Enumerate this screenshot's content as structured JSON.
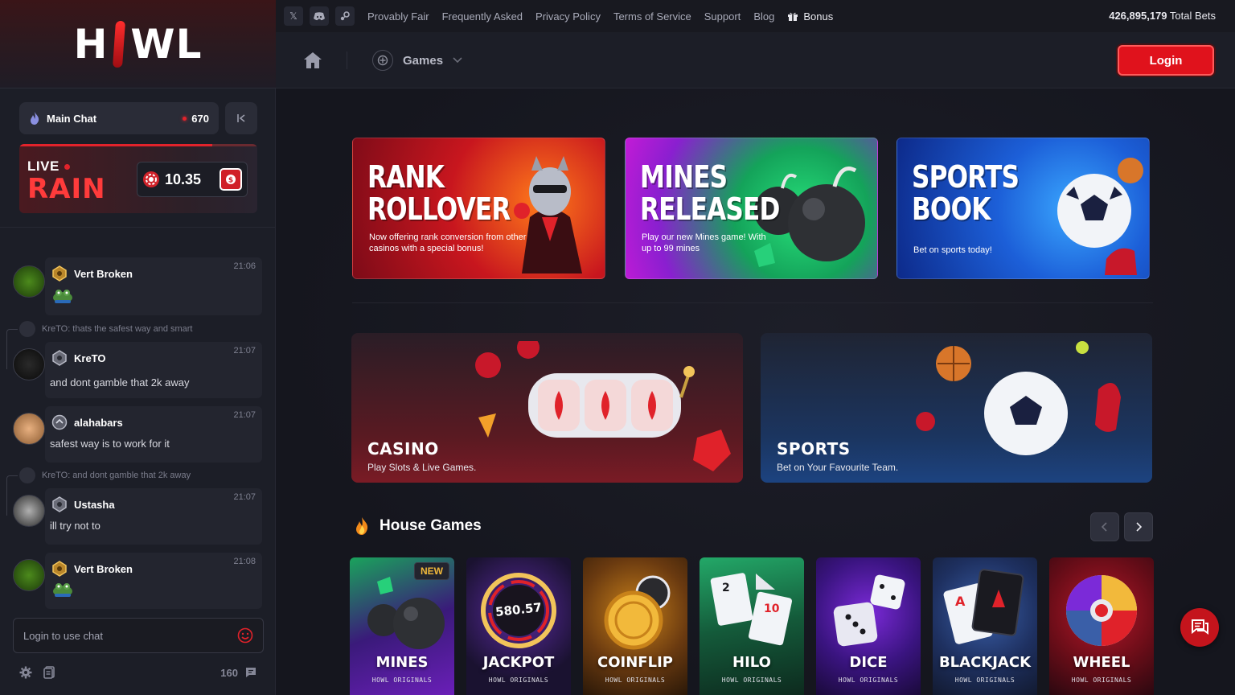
{
  "brand": {
    "logo_left": "H",
    "logo_right": "WL"
  },
  "topbar": {
    "links": [
      "Provably Fair",
      "Frequently Asked",
      "Privacy Policy",
      "Terms of Service",
      "Support",
      "Blog"
    ],
    "bonus_label": "Bonus",
    "total_bets_value": "426,895,179",
    "total_bets_label": "Total Bets"
  },
  "nav": {
    "games_label": "Games",
    "login_label": "Login"
  },
  "chat": {
    "room_name": "Main Chat",
    "online_count": "670",
    "rain": {
      "live_label": "LIVE",
      "rain_label": "RAIN",
      "amount": "10.35"
    },
    "messages": [
      {
        "name": "Vert Broken",
        "time": "21:06",
        "text": ""
      },
      {
        "reply": "KreTO: thats the safest way and smart",
        "name": "KreTO",
        "time": "21:07",
        "text": "and dont gamble that 2k away"
      },
      {
        "name": "alahabars",
        "time": "21:07",
        "text": "safest way is to work for it"
      },
      {
        "reply": "KreTO: and dont gamble that 2k away",
        "name": "Ustasha",
        "time": "21:07",
        "text": "ill try not to"
      },
      {
        "name": "Vert Broken",
        "time": "21:08",
        "text": ""
      }
    ],
    "input_placeholder": "Login to use chat",
    "footer_count": "160"
  },
  "banners": [
    {
      "title_line1": "RANK",
      "title_line2": "ROLLOVER",
      "subtitle": "Now offering rank conversion from other casinos with a special bonus!"
    },
    {
      "title_line1": "MINES",
      "title_line2": "RELEASED",
      "subtitle": "Play our new Mines game! With up to 99 mines"
    },
    {
      "title_line1": "SPORTS",
      "title_line2": "BOOK",
      "subtitle": "Bet on sports today!"
    }
  ],
  "categories": [
    {
      "title": "CASINO",
      "subtitle": "Play Slots & Live Games."
    },
    {
      "title": "SPORTS",
      "subtitle": "Bet on Your Favourite Team."
    }
  ],
  "house_games": {
    "title": "House Games",
    "games": [
      {
        "name": "MINES",
        "sub": "HOWL ORIGINALS",
        "badge": "NEW",
        "color1": "#1aa35c",
        "color2": "#6a1fb8"
      },
      {
        "name": "JACKPOT",
        "sub": "HOWL ORIGINALS",
        "display": "580.57",
        "color1": "#3a1570",
        "color2": "#1a1230"
      },
      {
        "name": "COINFLIP",
        "sub": "HOWL ORIGINALS",
        "color1": "#c9811a",
        "color2": "#3a2410"
      },
      {
        "name": "HILO",
        "sub": "HOWL ORIGINALS",
        "color1": "#23a868",
        "color2": "#0d3a28"
      },
      {
        "name": "DICE",
        "sub": "HOWL ORIGINALS",
        "color1": "#7b2ad8",
        "color2": "#2c1160"
      },
      {
        "name": "BLACKJACK",
        "sub": "HOWL ORIGINALS",
        "color1": "#3a5fa8",
        "color2": "#16203e"
      },
      {
        "name": "WHEEL",
        "sub": "HOWL ORIGINALS",
        "color1": "#b8182a",
        "color2": "#3a0d18"
      }
    ]
  },
  "colors": {
    "accent": "#e0121c",
    "sidebar": "#1c1e27",
    "background": "#15161e"
  }
}
